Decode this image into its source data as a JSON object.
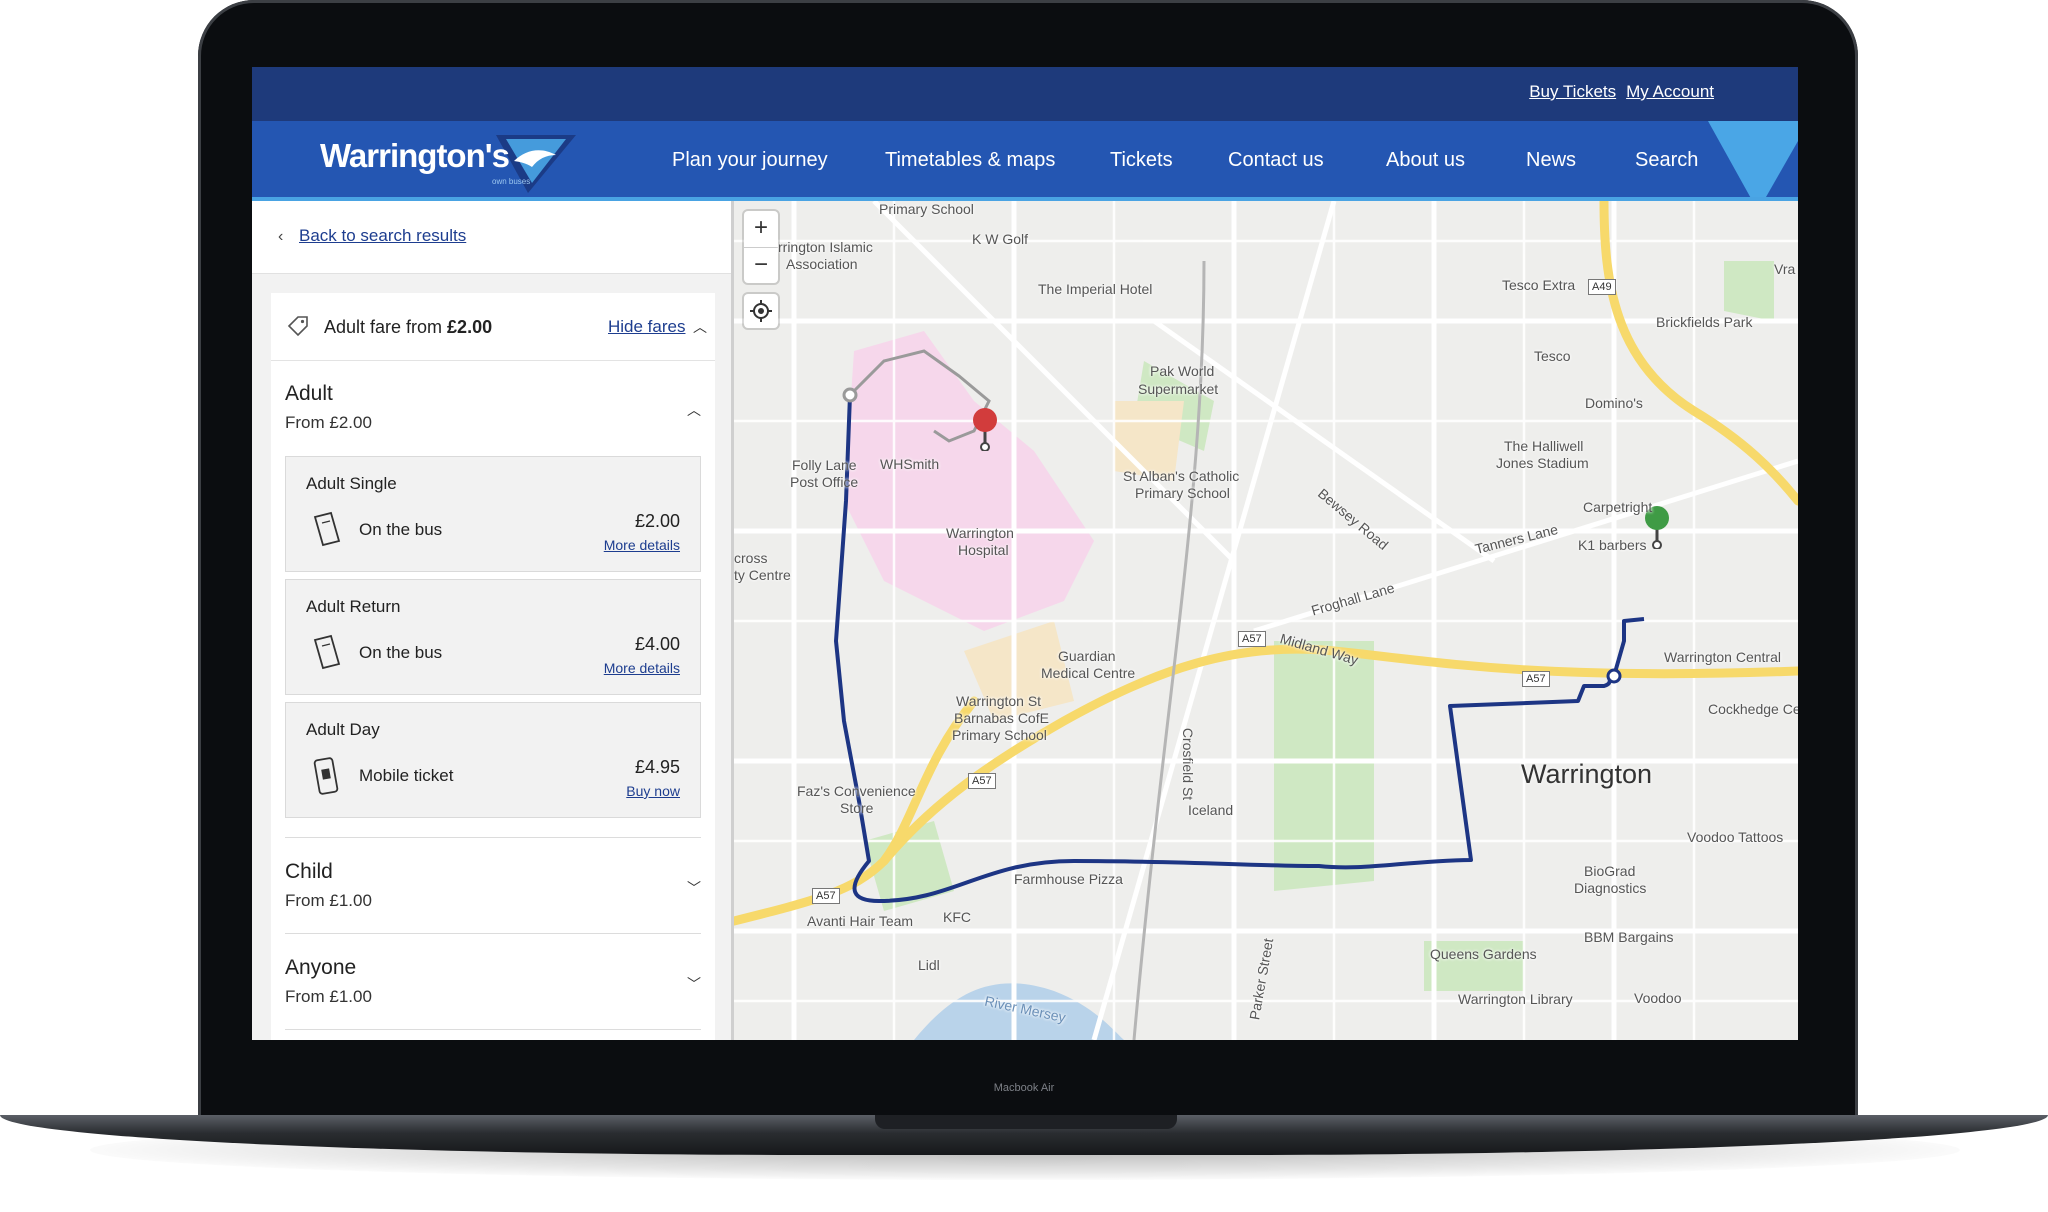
{
  "device": {
    "label": "Macbook Air"
  },
  "topbar": {
    "buy_tickets": "Buy Tickets",
    "my_account": "My Account"
  },
  "logo": {
    "name": "Warrington's",
    "sub": "own buses"
  },
  "nav": {
    "items": [
      "Plan your journey",
      "Timetables & maps",
      "Tickets",
      "Contact us",
      "About us",
      "News",
      "Search"
    ]
  },
  "sidebar": {
    "back_link": "Back to search results",
    "fare_summary_prefix": "Adult fare from ",
    "fare_summary_price": "£2.00",
    "hide_fares": "Hide fares",
    "groups": [
      {
        "title": "Adult",
        "from": "From £2.00",
        "expanded": true
      },
      {
        "title": "Child",
        "from": "From £1.00",
        "expanded": false
      },
      {
        "title": "Anyone",
        "from": "From £1.00",
        "expanded": false
      }
    ],
    "tickets": [
      {
        "name": "Adult Single",
        "desc": "On the bus",
        "price": "£2.00",
        "link": "More details",
        "icon": "ticket-icon"
      },
      {
        "name": "Adult Return",
        "desc": "On the bus",
        "price": "£4.00",
        "link": "More details",
        "icon": "ticket-icon"
      },
      {
        "name": "Adult Day",
        "desc": "Mobile ticket",
        "price": "£4.95",
        "link": "Buy now",
        "icon": "mobile-ticket-icon"
      }
    ]
  },
  "map": {
    "zoom_in": "+",
    "zoom_out": "−",
    "city": "Warrington",
    "labels": {
      "primary_school": "Primary School",
      "islamic": "rrington Islamic",
      "association": "Association",
      "kw_golf": "K W Golf",
      "imperial": "The Imperial Hotel",
      "tesco_extra": "Tesco Extra",
      "tesco": "Tesco",
      "brickfields": "Brickfields Park",
      "vra": "Vra",
      "pak_world": "Pak World",
      "supermarket": "Supermarket",
      "dominos": "Domino's",
      "halliwell1": "The Halliwell",
      "halliwell2": "Jones Stadium",
      "folly": "Folly Lane",
      "post_office": "Post Office",
      "whsmith": "WHSmith",
      "hospital1": "Warrington",
      "hospital2": "Hospital",
      "st_albans1": "St Alban's Catholic",
      "st_albans2": "Primary School",
      "bewsey": "Bewsey Road",
      "carpetright": "Carpetright",
      "tanners": "Tanners Lane",
      "k1": "K1 barbers",
      "cross1": "cross",
      "cross2": "ty Centre",
      "froghall": "Froghall Lane",
      "guardian1": "Guardian",
      "guardian2": "Medical Centre",
      "midland": "Midland Way",
      "central": "Warrington Central",
      "barnabas1": "Warrington St",
      "barnabas2": "Barnabas CofE",
      "barnabas3": "Primary School",
      "cockhedge": "Cockhedge Ce",
      "crosfield": "Crosfield St",
      "faz1": "Faz's Convenience",
      "faz2": "Store",
      "iceland": "Iceland",
      "voodoo_tattoos": "Voodoo Tattoos",
      "biograd1": "BioGrad",
      "biograd2": "Diagnostics",
      "farmhouse": "Farmhouse Pizza",
      "avanti": "Avanti Hair Team",
      "kfc": "KFC",
      "lidl": "Lidl",
      "bbm": "BBM Bargains",
      "queens": "Queens Gardens",
      "parker": "Parker Street",
      "library": "Warrington Library",
      "voodoo": "Voodoo",
      "river": "River Mersey"
    },
    "shields": {
      "a49": "A49",
      "a57_1": "A57",
      "a57_2": "A57",
      "a57_3": "A57",
      "a57_4": "A57"
    },
    "colors": {
      "route": "#1d3584",
      "start_pin": "#d23c3c",
      "end_pin": "#3f9b45",
      "main_road": "#f7d96b",
      "park": "#cfe8c3",
      "hospital": "#f6d7eb"
    }
  }
}
